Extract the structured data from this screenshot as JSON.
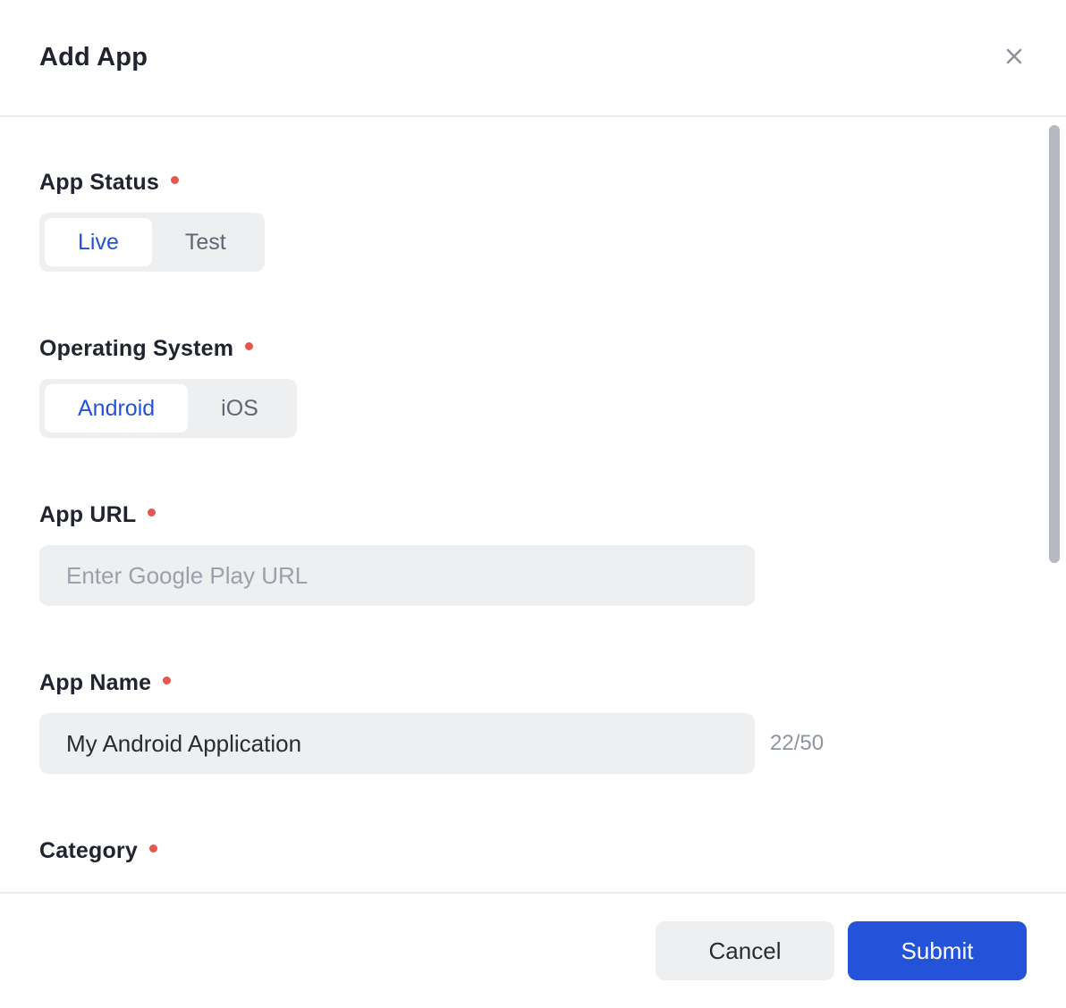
{
  "modal": {
    "title": "Add App"
  },
  "form": {
    "app_status": {
      "label": "App Status",
      "required": true,
      "options": [
        "Live",
        "Test"
      ],
      "selected": "Live"
    },
    "operating_system": {
      "label": "Operating System",
      "required": true,
      "options": [
        "Android",
        "iOS"
      ],
      "selected": "Android"
    },
    "app_url": {
      "label": "App URL",
      "required": true,
      "placeholder": "Enter Google Play URL",
      "value": ""
    },
    "app_name": {
      "label": "App Name",
      "required": true,
      "value": "My Android Application",
      "counter": "22/50"
    },
    "category": {
      "label": "Category",
      "required": true
    }
  },
  "footer": {
    "cancel_label": "Cancel",
    "submit_label": "Submit"
  },
  "colors": {
    "accent_blue": "#2452d8",
    "required_red": "#e4574e",
    "field_bg": "#edeff1",
    "label_text": "#20242e"
  }
}
